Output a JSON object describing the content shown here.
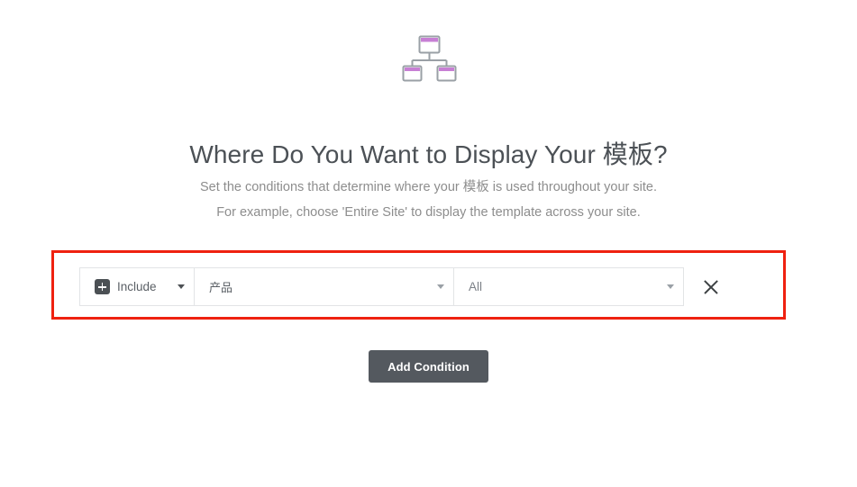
{
  "header": {
    "icon_name": "sitemap-icon",
    "title": "Where Do You Want to Display Your 模板?",
    "subtitle_line_1": "Set the conditions that determine where your 模板 is used throughout your site.",
    "subtitle_line_2": "For example, choose 'Entire Site' to display the template across your site."
  },
  "colors": {
    "highlight_border": "#ef2110",
    "button_background": "#54595f",
    "title_text": "#4c5156",
    "subtitle_text": "#8d8d8d",
    "icon_accent": "#c77fd4",
    "icon_outline": "#9aa0a6"
  },
  "conditions": {
    "rows": [
      {
        "include": {
          "label": "Include",
          "icon_name": "plus-icon",
          "caret_icon": "chevron-down-icon"
        },
        "source": {
          "label": "产品",
          "caret_icon": "chevron-down-icon"
        },
        "scope": {
          "label": "All",
          "caret_icon": "chevron-down-icon"
        },
        "remove": {
          "icon_name": "close-icon"
        }
      }
    ]
  },
  "actions": {
    "add_condition_label": "Add Condition"
  }
}
